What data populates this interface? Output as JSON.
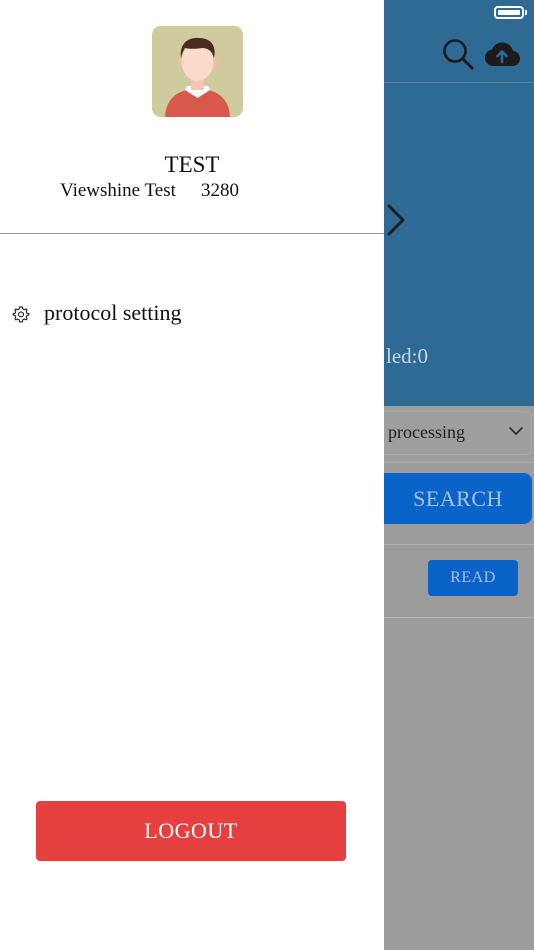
{
  "background": {
    "status_text": "led:0",
    "filter": {
      "selected": "processing"
    },
    "search_label": "SEARCH",
    "read_label": "READ",
    "colors": {
      "header": "#2e6a93",
      "button": "#0a63c9"
    }
  },
  "drawer": {
    "user": {
      "name": "TEST",
      "company": "Viewshine Test",
      "id": "3280"
    },
    "menu": [
      {
        "icon": "gear-icon",
        "label": "protocol setting"
      }
    ],
    "logout_label": "LOGOUT",
    "colors": {
      "logout": "#e53f3f",
      "avatar_bg": "#cfcb9f"
    }
  }
}
